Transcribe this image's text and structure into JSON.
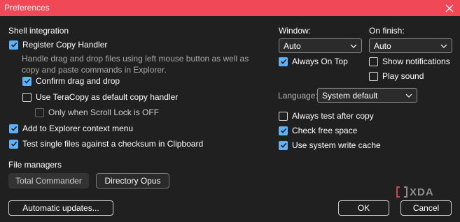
{
  "window": {
    "title": "Preferences"
  },
  "shell": {
    "heading": "Shell integration",
    "register_copy_handler": "Register Copy Handler",
    "description": "Handle drag and drop files using left mouse button as well as copy and paste commands in Explorer.",
    "confirm_drag_drop": "Confirm drag and drop",
    "use_default_copy_handler": "Use TeraCopy as default copy handler",
    "only_scroll_lock": "Only when Scroll Lock is OFF",
    "add_context_menu": "Add to Explorer context menu",
    "test_single_files": "Test single files against a checksum in Clipboard"
  },
  "file_managers": {
    "heading": "File managers",
    "total_commander": "Total Commander",
    "directory_opus": "Directory Opus"
  },
  "window_group": {
    "label": "Window:",
    "value": "Auto",
    "always_on_top": "Always On Top"
  },
  "finish_group": {
    "label": "On finish:",
    "value": "Auto",
    "show_notifications": "Show notifications",
    "play_sound": "Play sound"
  },
  "language": {
    "label": "Language:",
    "value": "System default"
  },
  "options": {
    "always_test": "Always test after copy",
    "check_free_space": "Check free space",
    "system_write_cache": "Use system write cache"
  },
  "footer": {
    "automatic_updates": "Automatic updates...",
    "ok": "OK",
    "cancel": "Cancel"
  },
  "watermark": {
    "text": "XDA"
  },
  "colors": {
    "titlebar": "#f04857",
    "background": "#202020",
    "accent": "#5db2ff"
  }
}
